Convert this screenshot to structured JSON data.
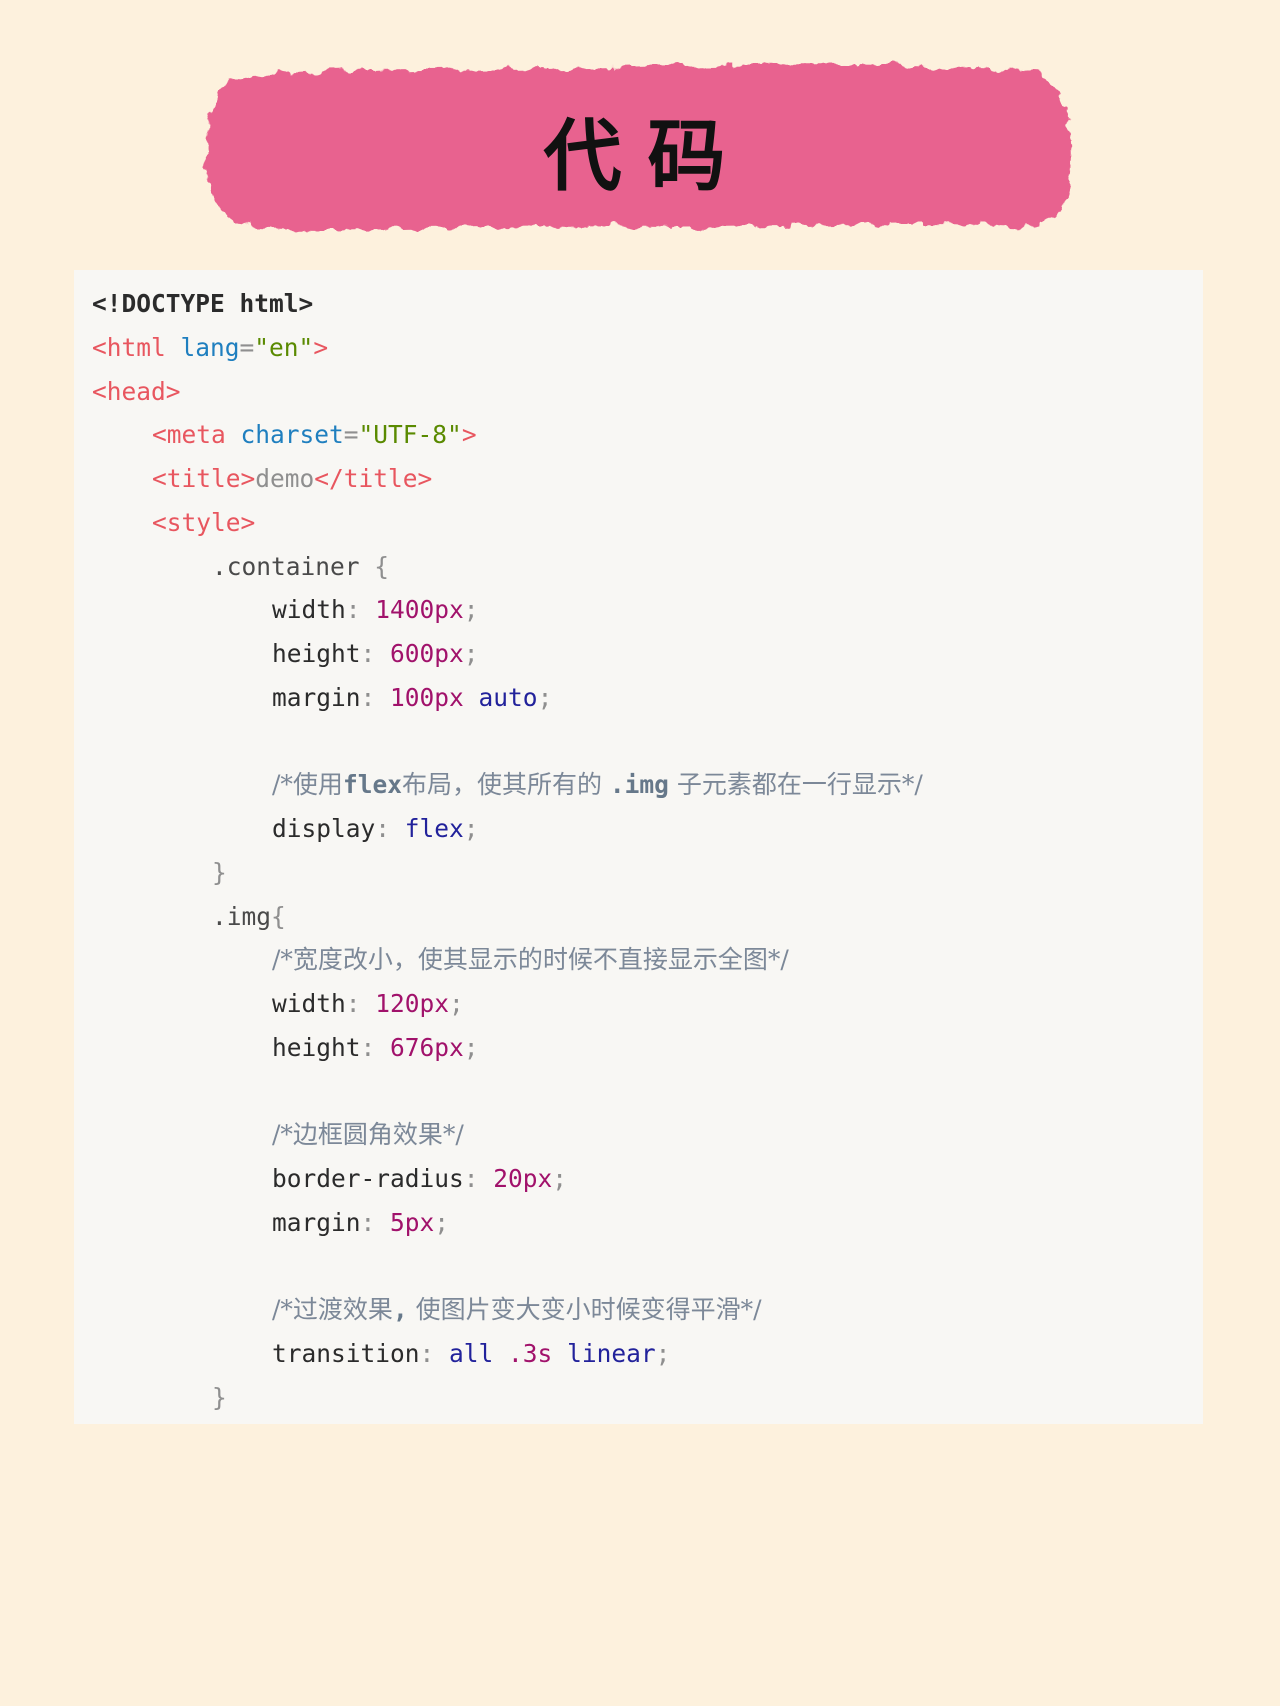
{
  "header": {
    "title": "代码",
    "banner_color": "#e8628f"
  },
  "code": {
    "l1": {
      "doctype": "<!DOCTYPE html>"
    },
    "l2": {
      "open": "<html",
      "attr": " lang",
      "eq": "=",
      "val": "\"en\"",
      "close": ">"
    },
    "l3": {
      "tag": "<head>"
    },
    "l4": {
      "open": "<meta",
      "attr": " charset",
      "eq": "=",
      "val": "\"UTF-8\"",
      "close": ">"
    },
    "l5": {
      "open": "<title>",
      "text": "demo",
      "close": "</title>"
    },
    "l6": {
      "tag": "<style>"
    },
    "l7": {
      "sel": ".container ",
      "brace": "{"
    },
    "l8": {
      "prop": "width",
      "colon": ": ",
      "val": "1400px",
      "semi": ";"
    },
    "l9": {
      "prop": "height",
      "colon": ": ",
      "val": "600px",
      "semi": ";"
    },
    "l10": {
      "prop": "margin",
      "colon": ": ",
      "val": "100px",
      "val2": " auto",
      "semi": ";"
    },
    "l12": {
      "c1": "/*使用",
      "c2": "flex",
      "c3": "布局，使其所有的 ",
      "c4": ".img",
      "c5": " 子元素都在一行显示*/"
    },
    "l13": {
      "prop": "display",
      "colon": ": ",
      "val": "flex",
      "semi": ";"
    },
    "l14": {
      "brace": "}"
    },
    "l15": {
      "sel": ".img",
      "brace": "{"
    },
    "l16": {
      "comment": "/*宽度改小，使其显示的时候不直接显示全图*/"
    },
    "l17": {
      "prop": "width",
      "colon": ": ",
      "val": "120px",
      "semi": ";"
    },
    "l18": {
      "prop": "height",
      "colon": ": ",
      "val": "676px",
      "semi": ";"
    },
    "l20": {
      "comment": "/*边框圆角效果*/"
    },
    "l21": {
      "prop": "border-radius",
      "colon": ": ",
      "val": "20px",
      "semi": ";"
    },
    "l22": {
      "prop": "margin",
      "colon": ": ",
      "val": "5px",
      "semi": ";"
    },
    "l24": {
      "c1": "/*过渡效果",
      "c2": ",",
      "c3": " 使图片变大变小时候变得平滑*/"
    },
    "l25": {
      "prop": "transition",
      "colon": ": ",
      "val": "all",
      "val2": " .3s",
      "val3": " linear",
      "semi": ";"
    },
    "l26": {
      "brace": "}"
    }
  }
}
